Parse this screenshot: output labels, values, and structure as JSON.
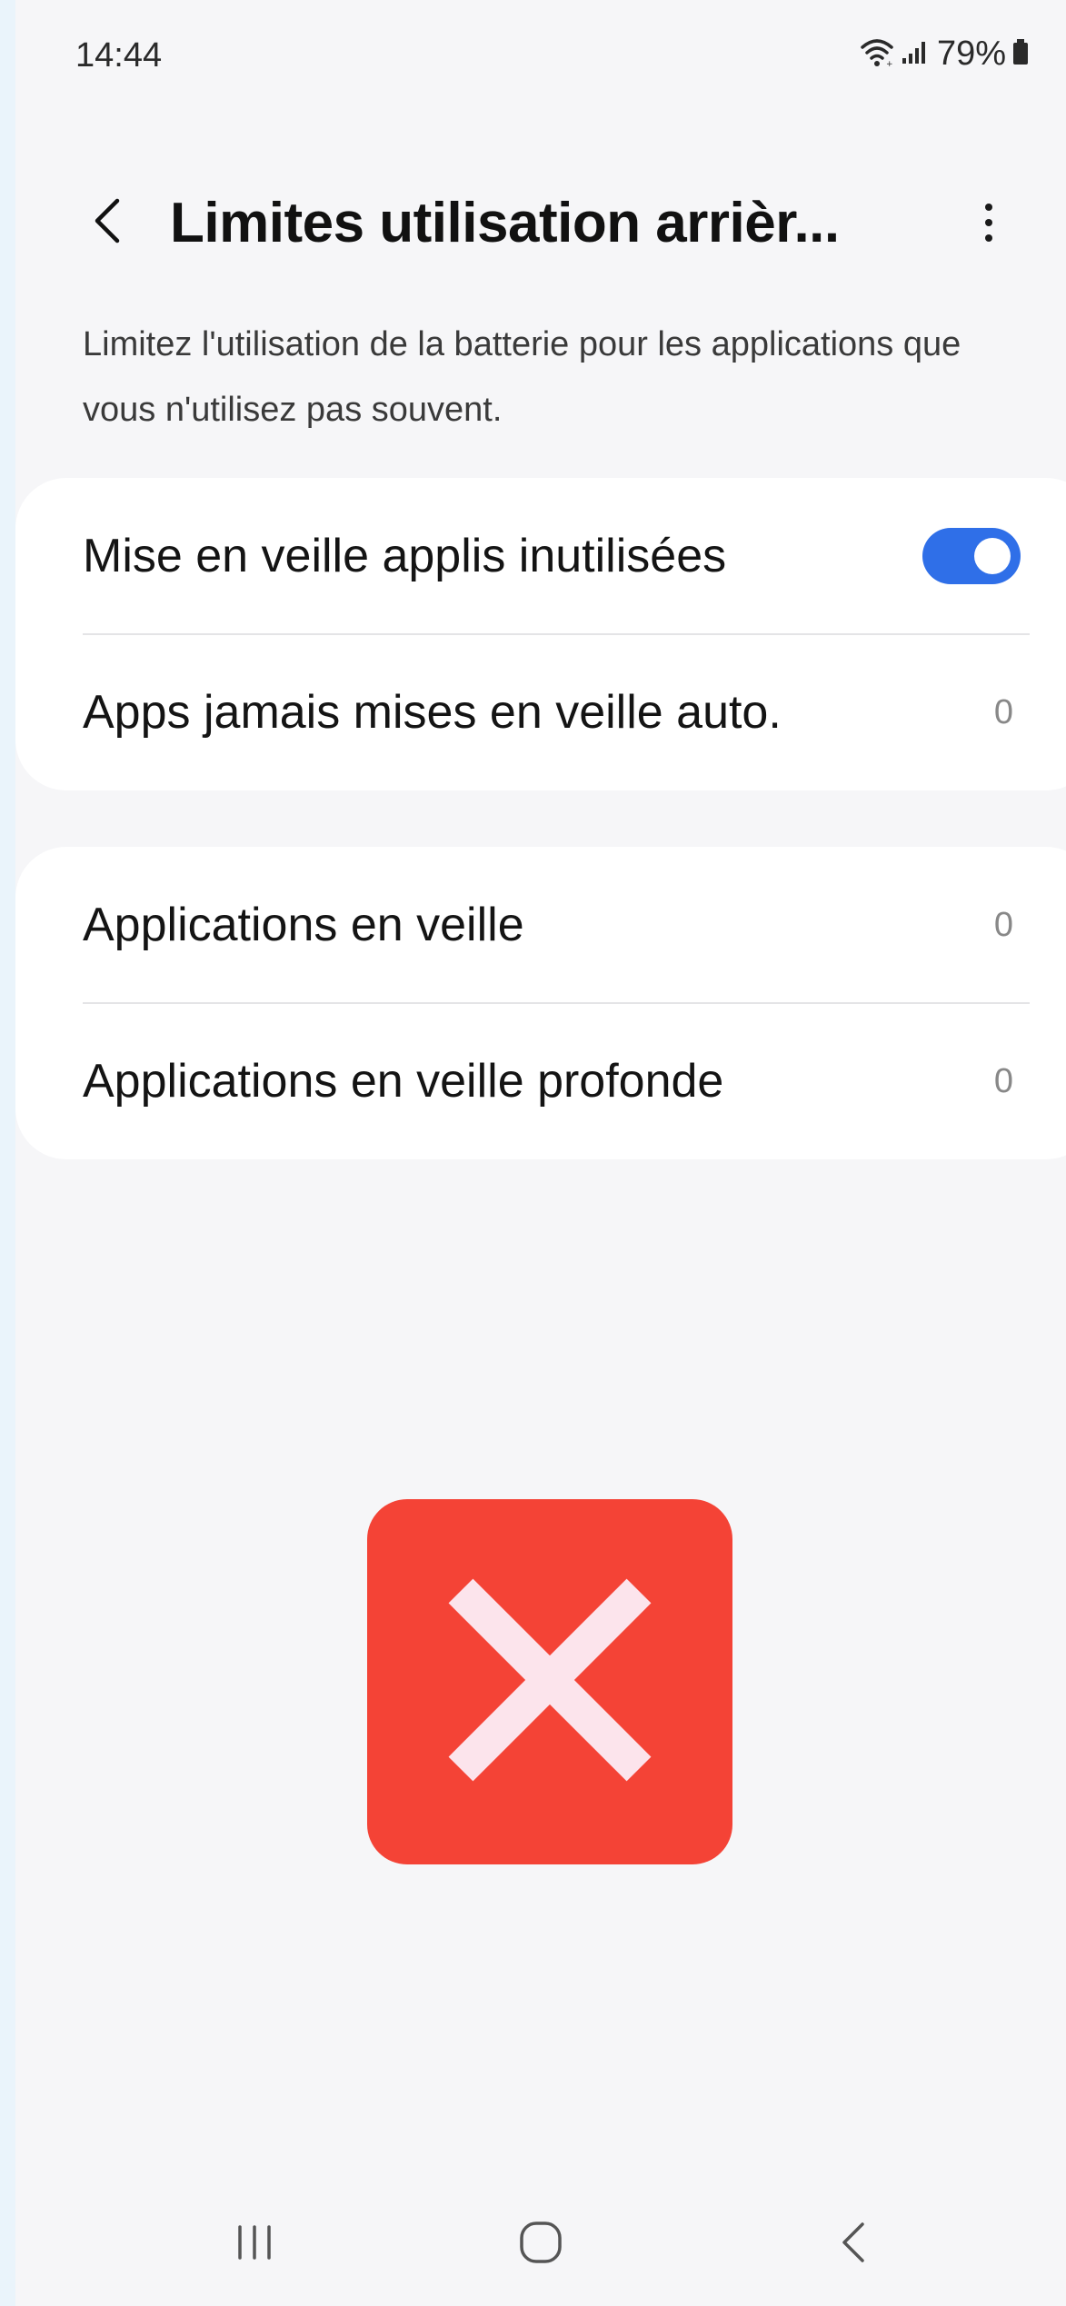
{
  "status_bar": {
    "time": "14:44",
    "battery_text": "79%",
    "icons": [
      "wifi-icon",
      "signal-icon",
      "battery-icon"
    ]
  },
  "top_bar": {
    "title": "Limites utilisation arrièr...",
    "back_icon": "chevron-left-icon",
    "more_icon": "more-vert-icon"
  },
  "description": "Limitez l'utilisation de la batterie pour les applications que vous n'utilisez pas souvent.",
  "card_1": {
    "rows": [
      {
        "label": "Mise en veille applis inutilisées",
        "toggle_on": true
      },
      {
        "label": "Apps jamais mises en veille auto.",
        "count": "0"
      }
    ]
  },
  "card_2": {
    "rows": [
      {
        "label": "Applications en veille",
        "count": "0"
      },
      {
        "label": "Applications en veille profonde",
        "count": "0"
      }
    ]
  },
  "overlay": {
    "icon": "close-x-icon",
    "color": "#f44336"
  },
  "nav_bar": {
    "icons": [
      "recents-icon",
      "home-icon",
      "back-icon"
    ]
  },
  "colors": {
    "accent": "#2f6fe8",
    "error": "#f44336",
    "error_glyph": "#fce4ec"
  }
}
